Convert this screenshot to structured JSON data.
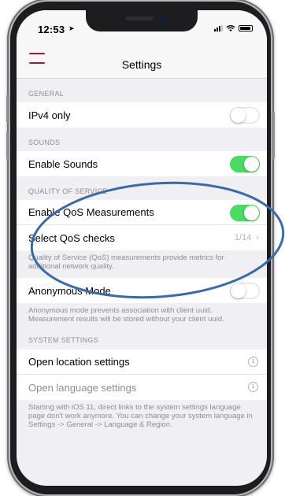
{
  "status_bar": {
    "time": "12:53",
    "location_icon": "location-arrow-icon",
    "signal_icon": "signal-icon",
    "wifi_icon": "wifi-icon",
    "battery_icon": "battery-icon"
  },
  "nav": {
    "title": "Settings",
    "menu_icon": "hamburger-menu-icon"
  },
  "accent_color": "#a01a3a",
  "toggle_on_color": "#4cd964",
  "annotation_color": "#3b6aa8",
  "sections": {
    "general": {
      "header": "GENERAL",
      "ipv4_label": "IPv4 only",
      "ipv4_on": false
    },
    "sounds": {
      "header": "SOUNDS",
      "enable_sounds_label": "Enable Sounds",
      "enable_sounds_on": true
    },
    "qos": {
      "header": "QUALITY OF SERVICE",
      "enable_label": "Enable QoS Measurements",
      "enable_on": true,
      "select_label": "Select QoS checks",
      "select_value": "1/14",
      "footer": "Quality of Service (QoS) measurements provide metrics for additional network quality."
    },
    "anonymous": {
      "label": "Anonymous Mode",
      "on": false,
      "footer": "Anonymous mode prevents association with client uuid. Measurement results will be stored without your client uuid."
    },
    "system": {
      "header": "SYSTEM SETTINGS",
      "location_label": "Open location settings",
      "language_label": "Open language settings",
      "footer": "Starting with iOS 11, direct links to the system settings language page don't work anymore. You can change your system language in Settings -> General -> Language & Region."
    }
  }
}
